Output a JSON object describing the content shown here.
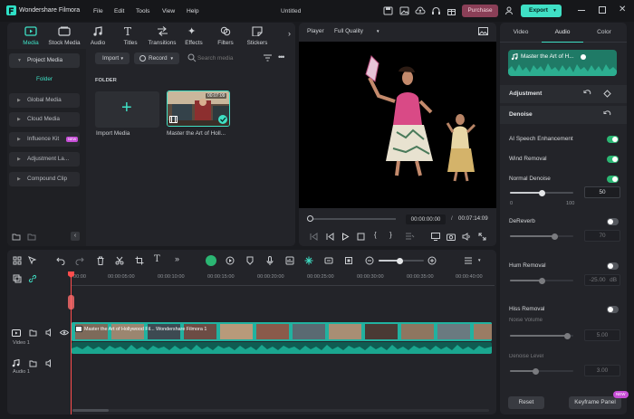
{
  "app": {
    "name": "Wondershare Filmora",
    "menu": [
      "File",
      "Edit",
      "Tools",
      "View",
      "Help"
    ],
    "project_title": "Untitled",
    "purchase_label": "Purchase",
    "export_label": "Export"
  },
  "media_tabs": [
    "Media",
    "Stock Media",
    "Audio",
    "Titles",
    "Transitions",
    "Effects",
    "Filters",
    "Stickers"
  ],
  "sidebar": {
    "items": [
      {
        "label": "Project Media"
      },
      {
        "label": "Folder"
      },
      {
        "label": "Global Media"
      },
      {
        "label": "Cloud Media"
      },
      {
        "label": "Influence Kit",
        "badge": "NEW"
      },
      {
        "label": "Adjustment La..."
      },
      {
        "label": "Compound Clip"
      }
    ]
  },
  "media_toolbar": {
    "import_label": "Import",
    "record_label": "Record",
    "search_placeholder": "Search media"
  },
  "media_area": {
    "folder_heading": "FOLDER",
    "import_tile_label": "Import Media",
    "clip_title": "Master the Art of Holl...",
    "clip_duration": "00:07:09"
  },
  "player": {
    "label": "Player",
    "quality": "Full Quality",
    "current_time": "00:00:00:00",
    "separator": "/",
    "total_time": "00:07:14:09"
  },
  "right_panel": {
    "tabs": [
      "Video",
      "Audio",
      "Color"
    ],
    "active_tab": "Audio",
    "clip_name": "Master the Art of H...",
    "adjustment_label": "Adjustment",
    "denoise_label": "Denoise",
    "controls": {
      "ai_speech": {
        "label": "AI Speech Enhancement",
        "on": true
      },
      "wind_removal": {
        "label": "Wind Removal",
        "on": true
      },
      "normal_denoise": {
        "label": "Normal Denoise",
        "on": true,
        "value": "50",
        "min": "0",
        "max": "100",
        "fraction": 0.5
      },
      "dereverb": {
        "label": "DeReverb",
        "on": false,
        "value": "70",
        "fraction": 0.7
      },
      "hum_removal": {
        "label": "Hum Removal",
        "on": false,
        "value": "-25.00",
        "unit": "dB",
        "fraction": 0.5
      },
      "hiss_removal": {
        "label": "Hiss Removal",
        "on": false
      },
      "noise_volume": {
        "label": "Noise Volume",
        "value": "5.00",
        "fraction": 0.9
      },
      "denoise_level": {
        "label": "Denoise Level",
        "value": "3.00",
        "fraction": 0.4
      }
    },
    "reset_label": "Reset",
    "keyframe_label": "Keyframe Panel",
    "keyframe_badge": "NEW"
  },
  "timeline": {
    "ruler_labels": [
      "00:00",
      "00:00:05:00",
      "00:00:10:00",
      "00:00:15:00",
      "00:00:20:00",
      "00:00:25:00",
      "00:00:30:00",
      "00:00:35:00",
      "00:00:40:00"
    ],
    "video_track_label": "Video 1",
    "audio_track_label": "Audio 1",
    "video_clip_title": "Master the Art of Hollywood Fil... Wondershare Filmora 1"
  },
  "colors": {
    "accent": "#3fe0c5",
    "purchase": "#8a3f57",
    "playhead": "#ff4d4d",
    "toggle_on": "#2bb673",
    "audio_wave": "#1aa68f",
    "video_clip": "#21b2a0"
  }
}
